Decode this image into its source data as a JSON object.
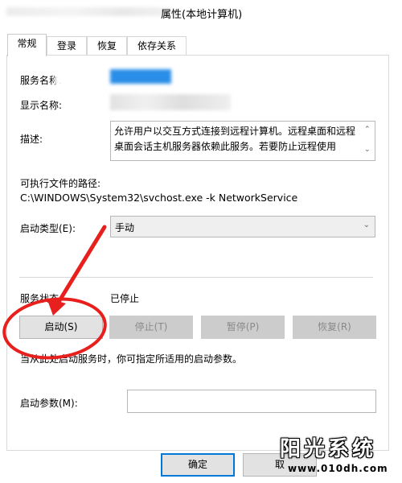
{
  "window": {
    "title": "属性(本地计算机)"
  },
  "tabs": [
    {
      "label": "常规",
      "active": true
    },
    {
      "label": "登录"
    },
    {
      "label": "恢复"
    },
    {
      "label": "依存关系"
    }
  ],
  "general": {
    "service_name_label": "服务名称:",
    "display_name_label": "显示名称:",
    "description_label": "描述:",
    "description_text": "允许用户以交互方式连接到远程计算机。远程桌面和远程桌面会话主机服务器依赖此服务。若要防止远程使用",
    "exe_path_label": "可执行文件的路径:",
    "exe_path_value": "C:\\WINDOWS\\System32\\svchost.exe -k NetworkService",
    "startup_type_label": "启动类型(E):",
    "startup_type_value": "手动",
    "service_status_label": "服务状态:",
    "service_status_value": "已停止",
    "start_params_hint": "当从此处启动服务时，你可指定所适用的启动参数。",
    "start_params_label": "启动参数(M):",
    "start_params_value": ""
  },
  "buttons": {
    "start": "启动(S)",
    "stop": "停止(T)",
    "pause": "暂停(P)",
    "resume": "恢复(R)",
    "ok": "确定",
    "cancel": "取"
  },
  "watermark": {
    "title": "阳光系统",
    "url": "www.010dh.com"
  },
  "colors": {
    "accent": "#0078d7",
    "annotation": "#e8201d",
    "blurred_name": "#2a8ee8"
  }
}
